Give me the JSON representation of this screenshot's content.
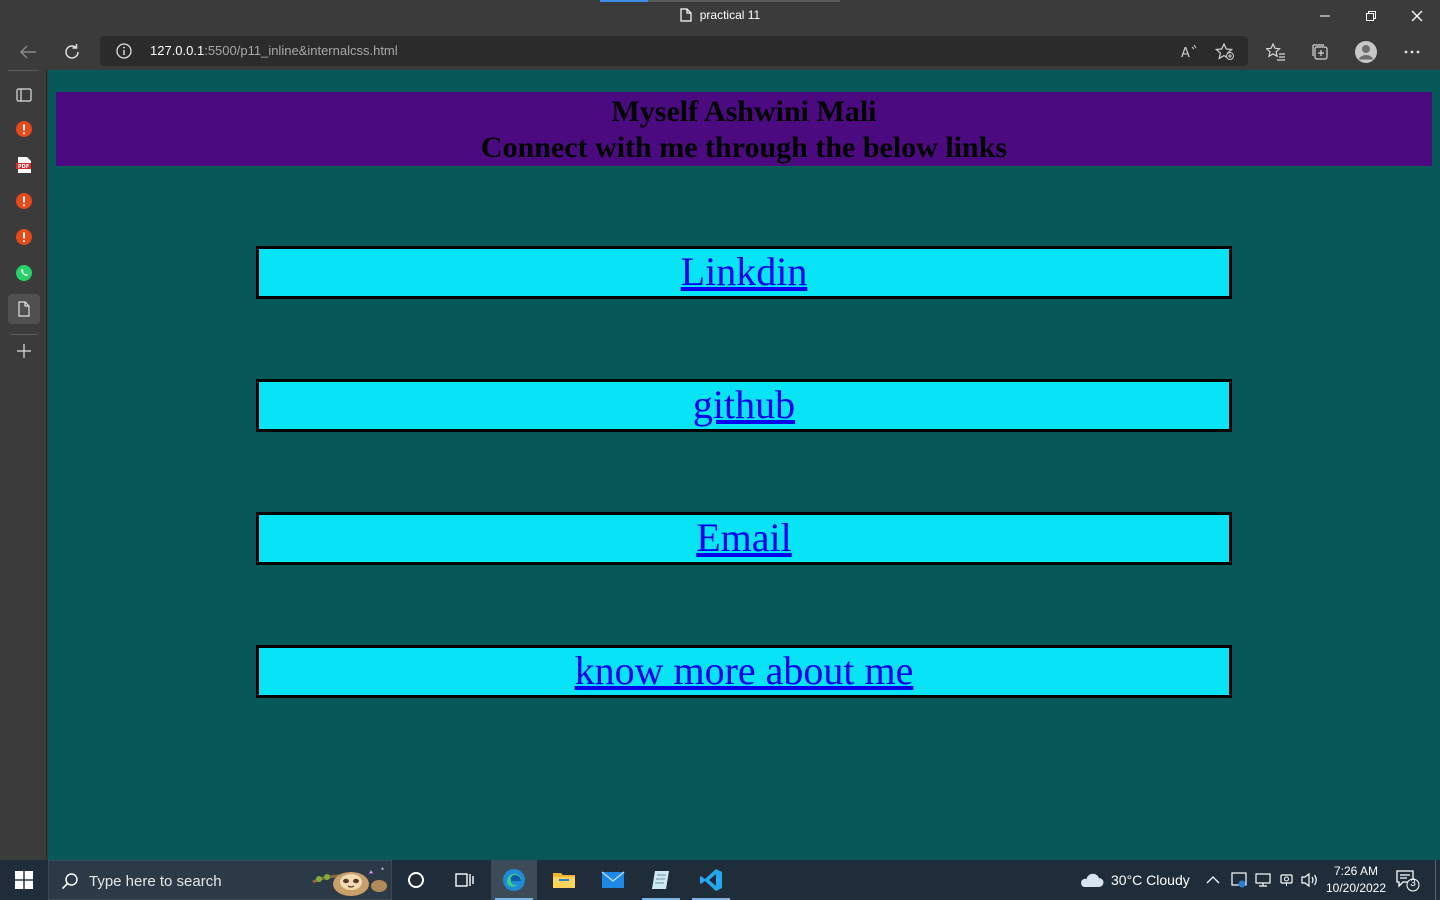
{
  "browser": {
    "tab_title": "practical 11",
    "url_host": "127.0.0.1",
    "url_rest": ":5500/p11_inline&internalcss.html"
  },
  "page": {
    "heading_line1": "Myself Ashwini Mali",
    "heading_line2": "Connect with me through the below links",
    "links": [
      {
        "label": "Linkdin"
      },
      {
        "label": "github"
      },
      {
        "label": "Email"
      },
      {
        "label": "know more about me"
      }
    ]
  },
  "taskbar": {
    "search_placeholder": "Type here to search",
    "weather": "30°C  Cloudy",
    "time": "7:26 AM",
    "date": "10/20/2022",
    "notification_count": "3"
  },
  "colors": {
    "page_bg": "#075959",
    "header_bg": "#4b0a80",
    "link_box_bg": "#08e3f5",
    "link_color": "#0000ee"
  }
}
